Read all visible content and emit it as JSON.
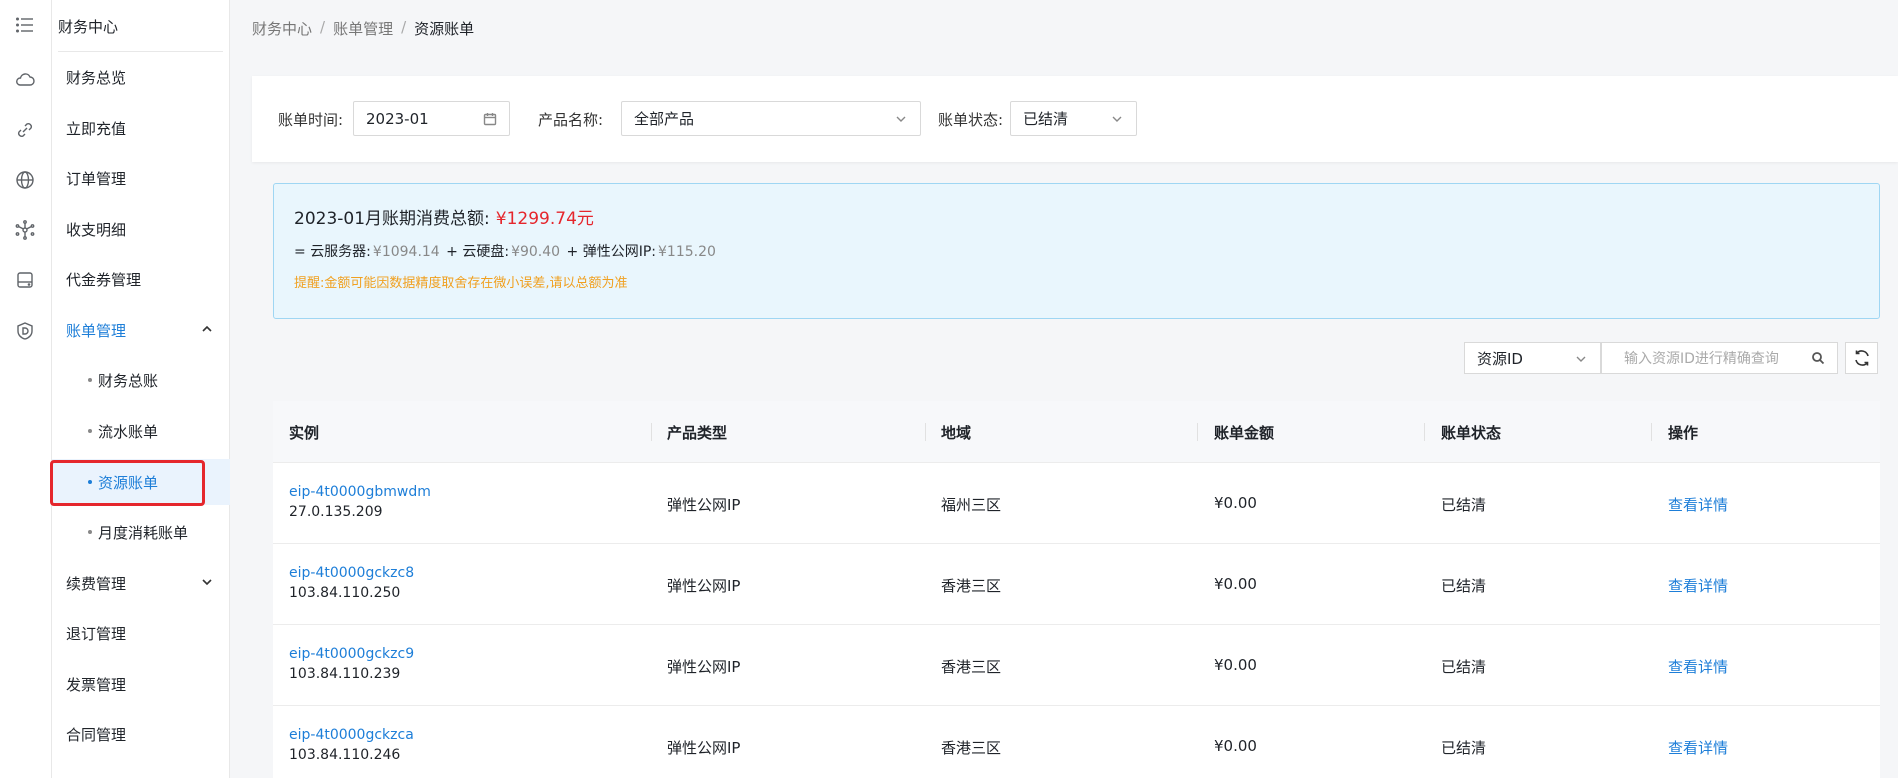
{
  "breadcrumb": [
    "财务中心",
    "账单管理",
    "资源账单"
  ],
  "sidebar": {
    "title": "财务中心",
    "items": [
      {
        "label": "财务总览"
      },
      {
        "label": "立即充值"
      },
      {
        "label": "订单管理"
      },
      {
        "label": "收支明细"
      },
      {
        "label": "代金券管理"
      },
      {
        "label": "账单管理"
      },
      {
        "label": "续费管理"
      },
      {
        "label": "退订管理"
      },
      {
        "label": "发票管理"
      },
      {
        "label": "合同管理"
      }
    ],
    "sub_items": [
      {
        "label": "财务总账"
      },
      {
        "label": "流水账单"
      },
      {
        "label": "资源账单"
      },
      {
        "label": "月度消耗账单"
      }
    ]
  },
  "rail_icons": [
    "menu-icon",
    "cloud-icon",
    "link-icon",
    "globe-icon",
    "network-icon",
    "storage-icon",
    "shield-icon"
  ],
  "filters": {
    "time_label": "账单时间:",
    "time_value": "2023-01",
    "product_label": "产品名称:",
    "product_value": "全部产品",
    "status_label": "账单状态:",
    "status_value": "已结清"
  },
  "summary": {
    "title": "2023-01月账期消费总额:",
    "total": "¥1299.74元",
    "eq": "=",
    "parts": [
      {
        "name": "云服务器:",
        "value": "¥1094.14"
      },
      {
        "name": "云硬盘:",
        "value": "¥90.40"
      },
      {
        "name": "弹性公网IP:",
        "value": "¥115.20"
      }
    ],
    "plus": "+",
    "note": "提醒:金额可能因数据精度取舍存在微小误差,请以总额为准"
  },
  "search": {
    "select_value": "资源ID",
    "placeholder": "输入资源ID进行精确查询"
  },
  "table": {
    "headers": [
      "实例",
      "产品类型",
      "地域",
      "账单金额",
      "账单状态",
      "操作"
    ],
    "rows": [
      {
        "id": "eip-4t0000gbmwdm",
        "ip": "27.0.135.209",
        "type": "弹性公网IP",
        "region": "福州三区",
        "amount": "¥0.00",
        "status": "已结清",
        "action": "查看详情"
      },
      {
        "id": "eip-4t0000gckzc8",
        "ip": "103.84.110.250",
        "type": "弹性公网IP",
        "region": "香港三区",
        "amount": "¥0.00",
        "status": "已结清",
        "action": "查看详情"
      },
      {
        "id": "eip-4t0000gckzc9",
        "ip": "103.84.110.239",
        "type": "弹性公网IP",
        "region": "香港三区",
        "amount": "¥0.00",
        "status": "已结清",
        "action": "查看详情"
      },
      {
        "id": "eip-4t0000gckzca",
        "ip": "103.84.110.246",
        "type": "弹性公网IP",
        "region": "香港三区",
        "amount": "¥0.00",
        "status": "已结清",
        "action": "查看详情"
      }
    ]
  },
  "colors": {
    "accent": "#1d7ed8",
    "danger": "#e5262c",
    "warning": "#f0a020",
    "info_bg": "#e9f6fd"
  }
}
